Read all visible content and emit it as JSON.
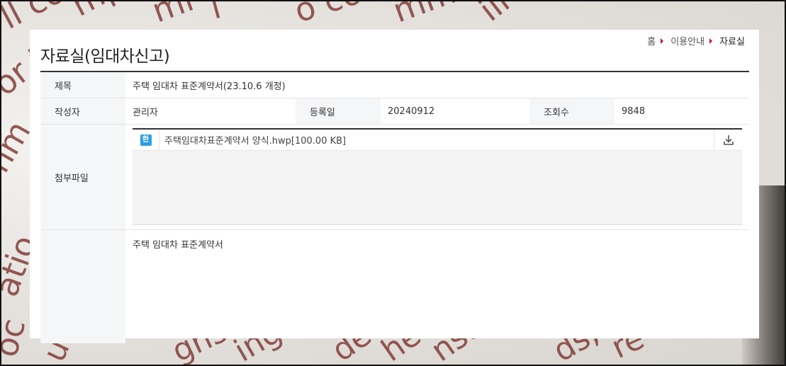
{
  "breadcrumb": {
    "home": "홈",
    "section": "이용안내",
    "current": "자료실"
  },
  "page": {
    "title": "자료실(임대차신고)"
  },
  "post": {
    "title_label": "제목",
    "title_value": "주택 임대차 표준계약서(23.10.6 개정)",
    "author_label": "작성자",
    "author_value": "관리자",
    "date_label": "등록일",
    "date_value": "20240912",
    "views_label": "조회수",
    "views_value": "9848",
    "attach_label": "첨부파일",
    "content": "주택 임대차 표준계약서"
  },
  "attachments": [
    {
      "icon": "hwp-file-icon",
      "type_glyph": "한",
      "name": "주택임대차표준계약서 양식.hwp[100.00 KB]"
    }
  ],
  "colors": {
    "accent": "#c8102e",
    "hwp_icon": "#2d9fdc",
    "header_bg": "#f5f6f8"
  }
}
